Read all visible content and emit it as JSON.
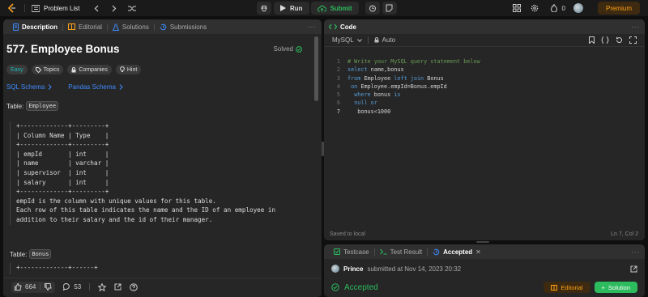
{
  "topbar": {
    "problem_list_label": "Problem List",
    "run_label": "Run",
    "submit_label": "Submit",
    "fire_count": "0",
    "premium_label": "Premium"
  },
  "left_panel": {
    "tabs": [
      {
        "label": "Description",
        "icon": "doc-icon",
        "active": true
      },
      {
        "label": "Editorial",
        "icon": "book-icon",
        "active": false
      },
      {
        "label": "Solutions",
        "icon": "flask-icon",
        "active": false
      },
      {
        "label": "Submissions",
        "icon": "history-icon",
        "active": false
      }
    ],
    "title": "577. Employee Bonus",
    "solved_label": "Solved",
    "tags": {
      "difficulty": "Easy",
      "topics": "Topics",
      "companies": "Companies",
      "hint": "Hint"
    },
    "schema_links": {
      "sql": "SQL Schema",
      "pandas": "Pandas Schema"
    },
    "table1_label": "Table:",
    "table1_name": "Employee",
    "table1_pre": "+-------------+---------+\n| Column Name | Type    |\n+-------------+---------+\n| empId       | int     |\n| name        | varchar |\n| supervisor  | int     |\n| salary      | int     |\n+-------------+---------+\nempId is the column with unique values for this table.\nEach row of this table indicates the name and the ID of an employee in\naddition to their salary and the id of their manager.",
    "table2_label": "Table:",
    "table2_name": "Bonus",
    "table2_pre": "+-------------+------+",
    "bottom": {
      "likes": "664",
      "comments": "53"
    }
  },
  "code_panel": {
    "title": "Code",
    "language": "MySQL",
    "auto_label": "Auto",
    "line_numbers": [
      "1",
      "2",
      "3",
      "4",
      "5",
      "6",
      "7"
    ],
    "status_left": "Saved to local",
    "status_right": "Ln 7, Col 2"
  },
  "result_panel": {
    "tabs": [
      {
        "label": "Testcase"
      },
      {
        "label": "Test Result"
      },
      {
        "label": "Accepted"
      }
    ],
    "user": "Prince",
    "submitted_text": "submitted at Nov 14, 2023 20:32",
    "status": "Accepted",
    "editorial_label": "Editorial",
    "solution_label": "Solution"
  },
  "colors": {
    "accent_green": "#2cbb5d",
    "premium_orange": "#ffa116",
    "link_blue": "#3d8bfd",
    "easy_teal": "#1cbaba"
  }
}
